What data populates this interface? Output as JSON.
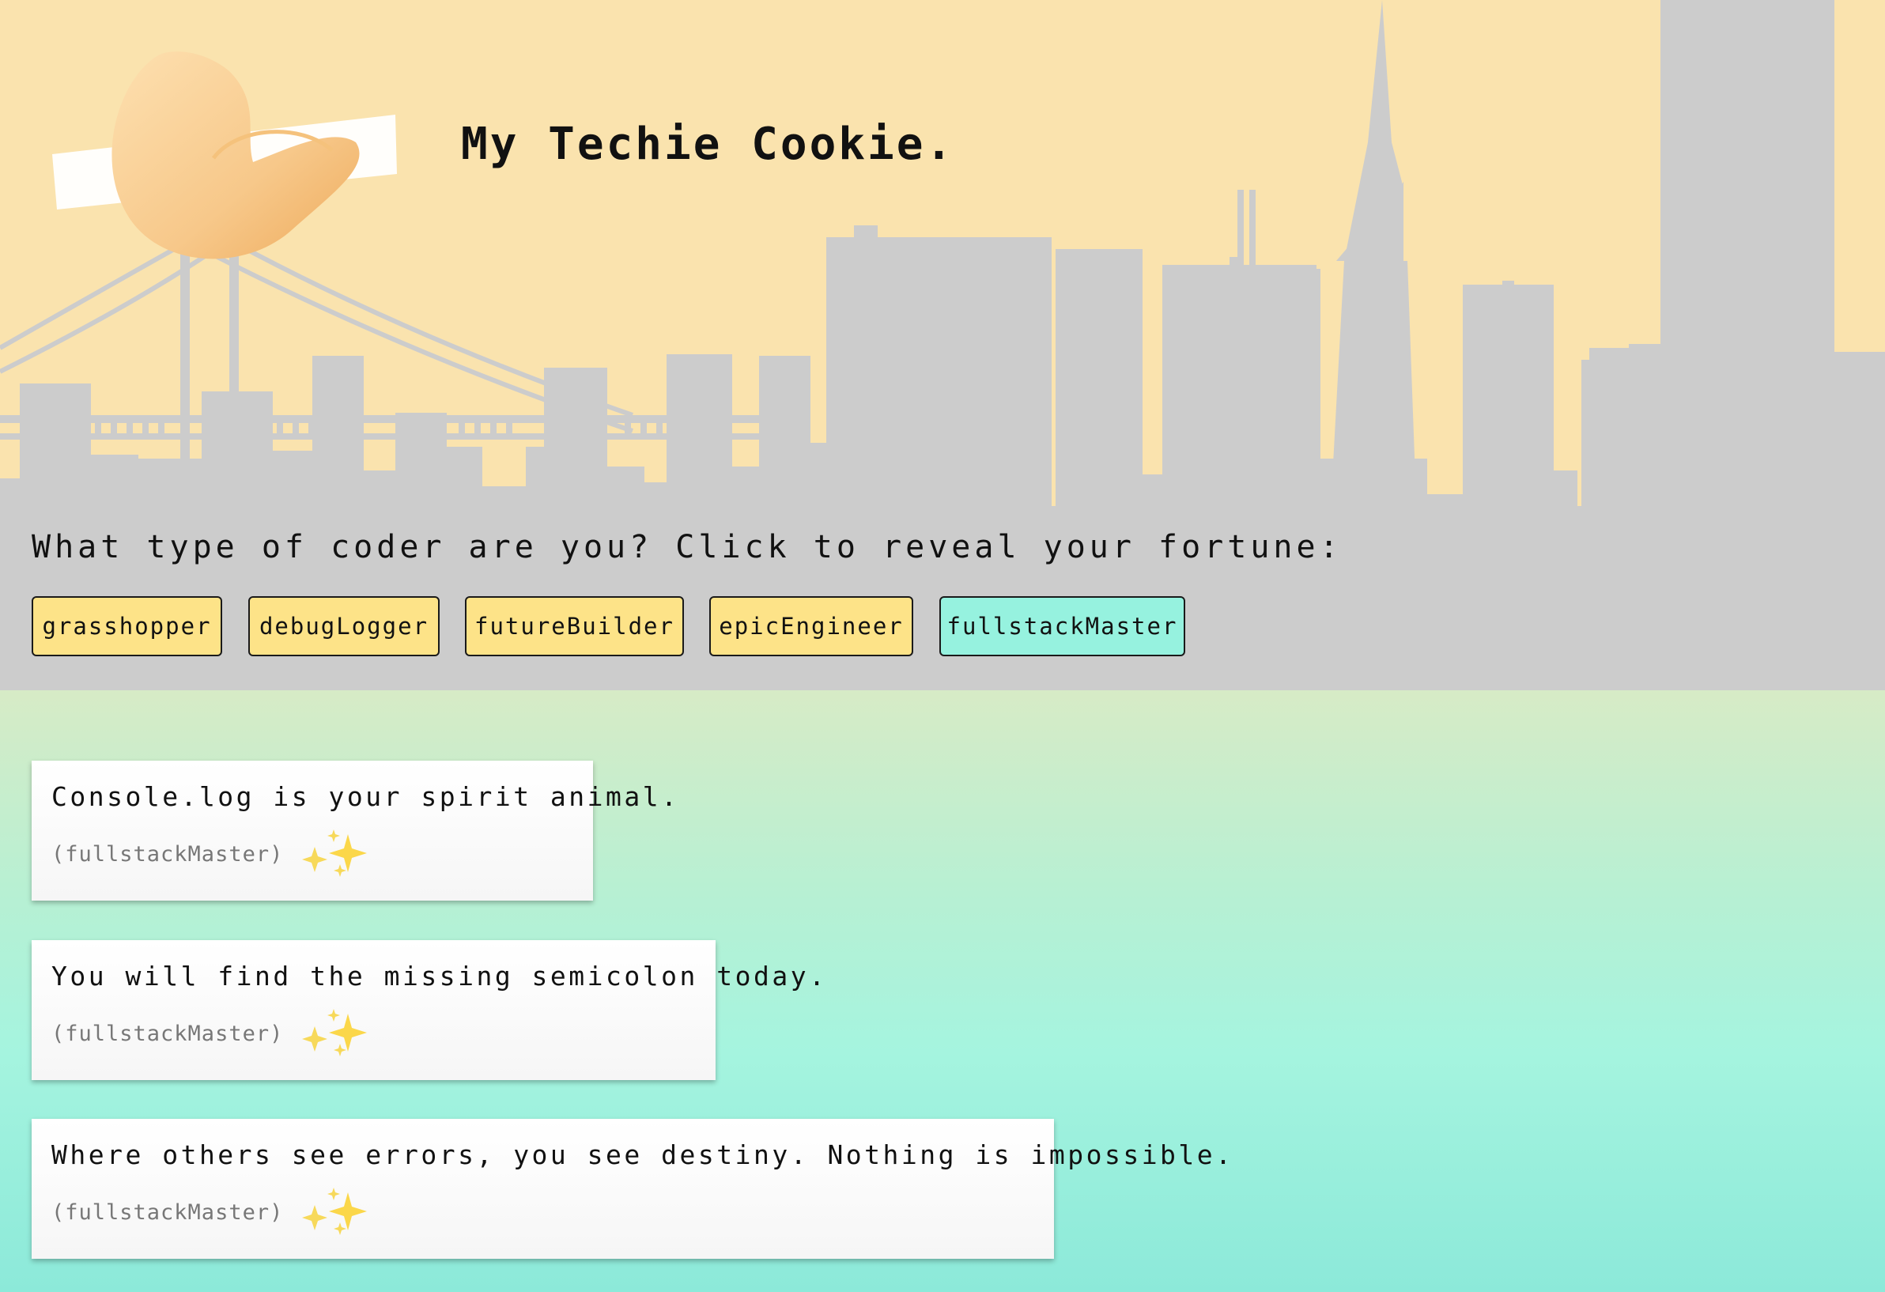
{
  "header": {
    "title": "My Techie Cookie."
  },
  "prompt": "What type of coder are you? Click to reveal your fortune:",
  "coder_types": [
    {
      "label": "grasshopper"
    },
    {
      "label": "debugLogger"
    },
    {
      "label": "futureBuilder"
    },
    {
      "label": "epicEngineer"
    },
    {
      "label": "fullstackMaster",
      "active": true
    }
  ],
  "fortunes": [
    {
      "text": "Console.log is your spirit animal.",
      "tag": "(fullstackMaster)"
    },
    {
      "text": "You will find the missing semicolon today.",
      "tag": "(fullstackMaster)"
    },
    {
      "text": "Where others see errors, you see destiny. Nothing is impossible.",
      "tag": "(fullstackMaster)"
    }
  ],
  "icons": {
    "logo": "fortune-cookie-icon",
    "sparkle": "sparkles-icon",
    "background": "city-skyline-illustration"
  },
  "colors": {
    "sky": "#fae3ae",
    "skyline": "#cccccc",
    "button": "#fde388",
    "button_active": "#96f2df"
  }
}
